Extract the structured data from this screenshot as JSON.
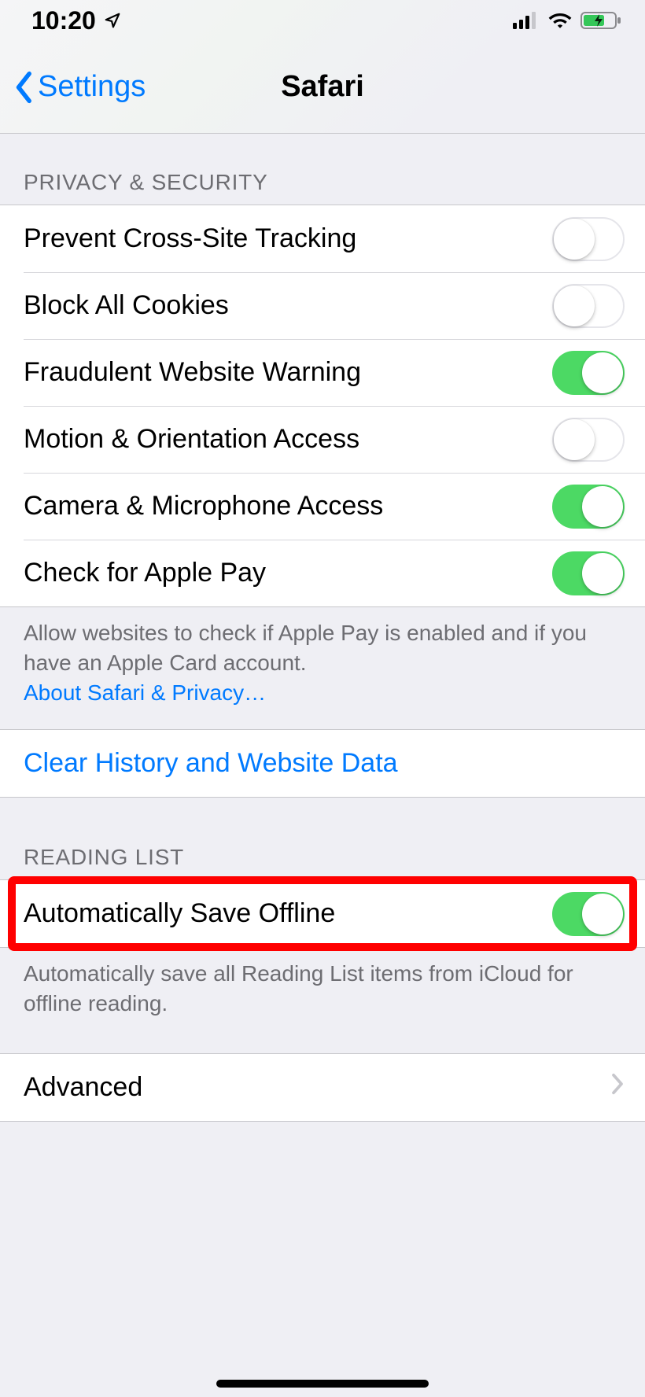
{
  "status": {
    "time": "10:20"
  },
  "nav": {
    "back_label": "Settings",
    "title": "Safari"
  },
  "sections": {
    "privacy": {
      "header": "PRIVACY & SECURITY",
      "prevent_tracking": {
        "label": "Prevent Cross-Site Tracking",
        "on": false
      },
      "block_cookies": {
        "label": "Block All Cookies",
        "on": false
      },
      "fraud_warning": {
        "label": "Fraudulent Website Warning",
        "on": true
      },
      "motion_access": {
        "label": "Motion & Orientation Access",
        "on": false
      },
      "camera_mic": {
        "label": "Camera & Microphone Access",
        "on": true
      },
      "apple_pay": {
        "label": "Check for Apple Pay",
        "on": true
      },
      "footer_text": "Allow websites to check if Apple Pay is enabled and if you have an Apple Card account.",
      "footer_link": "About Safari & Privacy…"
    },
    "clear": {
      "label": "Clear History and Website Data"
    },
    "reading_list": {
      "header": "READING LIST",
      "auto_save": {
        "label": "Automatically Save Offline",
        "on": true
      },
      "footer_text": "Automatically save all Reading List items from iCloud for offline reading."
    },
    "advanced": {
      "label": "Advanced"
    }
  }
}
